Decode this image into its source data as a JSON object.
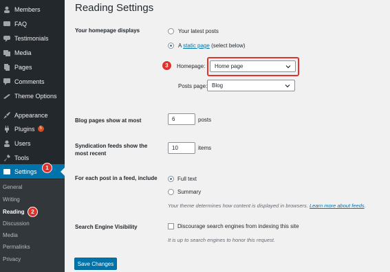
{
  "sidebar": {
    "items": [
      {
        "label": "Members",
        "icon": "members-icon"
      },
      {
        "label": "FAQ",
        "icon": "faq-icon"
      },
      {
        "label": "Testimonials",
        "icon": "testimonials-icon"
      },
      {
        "label": "Media",
        "icon": "media-icon"
      },
      {
        "label": "Pages",
        "icon": "pages-icon"
      },
      {
        "label": "Comments",
        "icon": "comments-icon"
      },
      {
        "label": "Theme Options",
        "icon": "theme-options-icon"
      },
      {
        "label": "Appearance",
        "icon": "appearance-icon"
      },
      {
        "label": "Plugins",
        "icon": "plugins-icon",
        "badge": "5"
      },
      {
        "label": "Users",
        "icon": "users-icon"
      },
      {
        "label": "Tools",
        "icon": "tools-icon"
      },
      {
        "label": "Settings",
        "icon": "settings-icon"
      }
    ],
    "submenu": [
      "General",
      "Writing",
      "Reading",
      "Discussion",
      "Media",
      "Permalinks",
      "Privacy"
    ],
    "callouts": {
      "settings": "1",
      "reading": "2"
    }
  },
  "page": {
    "title": "Reading Settings"
  },
  "homepage_displays": {
    "label": "Your homepage displays",
    "option_latest": "Your latest posts",
    "option_static_prefix": "A",
    "option_static_link": "static page",
    "option_static_suffix": "(select below)",
    "homepage_label": "Homepage:",
    "homepage_value": "Home page",
    "posts_page_label": "Posts page:",
    "posts_page_value": "Blog",
    "callout": "3"
  },
  "blog_pages": {
    "label": "Blog pages show at most",
    "value": "6",
    "unit": "posts"
  },
  "syndication": {
    "label_line1": "Syndication feeds show the",
    "label_line2": "most recent",
    "value": "10",
    "unit": "items"
  },
  "feed": {
    "label": "For each post in a feed, include",
    "option_full": "Full text",
    "option_summary": "Summary",
    "desc_prefix": "Your theme determines how content is displayed in browsers.",
    "desc_link1": "Learn more about",
    "desc_link2": "feeds",
    "desc_suffix": "."
  },
  "search_engine": {
    "label": "Search Engine Visibility",
    "checkbox_label": "Discourage search engines from indexing this site",
    "desc": "It is up to search engines to honor this request."
  },
  "save_button": "Save Changes",
  "colors": {
    "sidebar_bg": "#23282d",
    "active_bg": "#0073aa",
    "callout": "#e0322b",
    "link": "#0073aa"
  }
}
